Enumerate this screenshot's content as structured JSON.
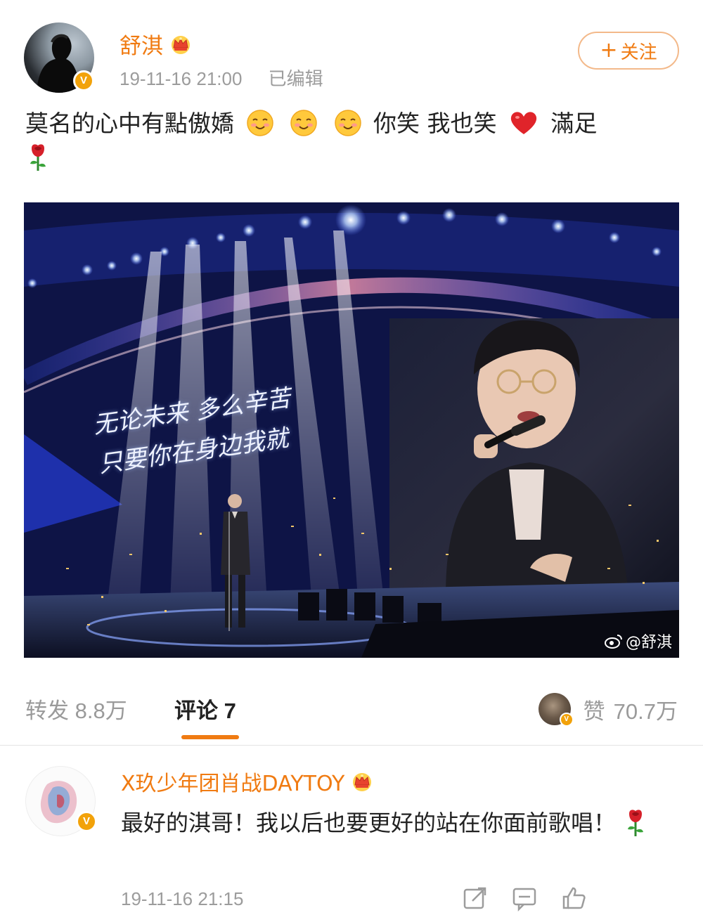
{
  "post": {
    "author": {
      "name": "舒淇",
      "verified_badge": "V",
      "crown_icon": "crown-icon",
      "avatar_icon": "user-avatar"
    },
    "timestamp": "19-11-16 21:00",
    "edited_label": "已编辑",
    "follow_button": {
      "plus": "+",
      "label": "关注"
    },
    "text": {
      "part1": "莫名的心中有點傲嬌",
      "part2": "你笑 我也笑",
      "part3": "滿足",
      "emoji": [
        "smiling-face-icon",
        "smiling-face-icon",
        "smiling-face-icon",
        "red-heart-icon",
        "rose-icon"
      ]
    },
    "image": {
      "lyrics_line1": "无论未来 多么辛苦",
      "lyrics_line2": "只要你在身边我就",
      "watermark": "@舒淇",
      "watermark_icon": "weibo-logo-icon"
    }
  },
  "stats": {
    "repost_label": "转发",
    "repost_count": "8.8万",
    "comment_label": "评论",
    "comment_count": "7",
    "like_label": "赞",
    "like_count": "70.7万",
    "liker_badge": "V"
  },
  "comment": {
    "author": "X玖少年团肖战DAYTOY",
    "verified_badge": "V",
    "text": "最好的淇哥！我以后也要更好的站在你面前歌唱！",
    "emoji": "rose-icon",
    "timestamp": "19-11-16 21:15",
    "actions": [
      "share-icon",
      "reply-icon",
      "like-icon"
    ]
  },
  "colors": {
    "accent": "#f07b12",
    "badge": "#f2a20a",
    "muted_text": "#9c9c9c"
  }
}
